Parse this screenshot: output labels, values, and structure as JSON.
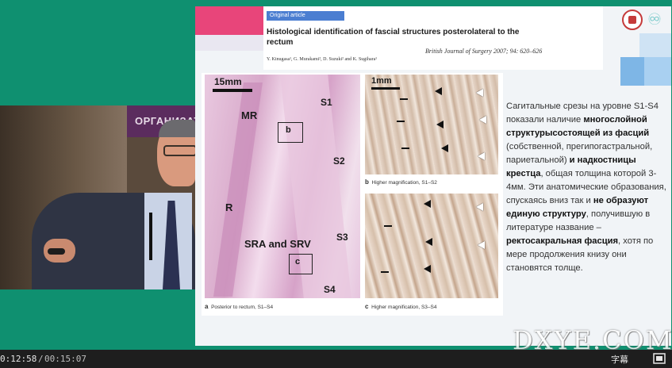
{
  "player": {
    "time_current": "0:12:58",
    "time_separator": "/",
    "time_total": "00:15:07",
    "subtitle_button": "字幕",
    "watermark": "DXYE.COM"
  },
  "speaker_video": {
    "background_sign": "ОРГАНИЗАТО"
  },
  "slide": {
    "article_label": "Original article",
    "article_title": "Histological identification of fascial structures posterolateral to the rectum",
    "journal_citation": "British Journal of Surgery 2007; 94: 620–626",
    "authors": "Y. Kinugasa¹, G. Murakami², D. Suzuki² and K. Sugihara¹",
    "figure": {
      "panel_a": {
        "scale": "15mm",
        "labels": [
          "MR",
          "b",
          "S1",
          "S2",
          "R",
          "S3",
          "SRA and SRV",
          "c",
          "S4"
        ],
        "caption_letter": "a",
        "caption_text": "Posterior to rectum, S1–S4"
      },
      "panel_b": {
        "scale": "1mm",
        "caption_letter": "b",
        "caption_text": "Higher magnification, S1–S2"
      },
      "panel_c": {
        "caption_letter": "c",
        "caption_text": "Higher magnification, S3–S4"
      }
    },
    "body_segments": [
      {
        "text": "Сагитальные срезы на уровне S1-S4 показали наличие ",
        "bold": false
      },
      {
        "text": "многослойной структурысостоящей из фасций",
        "bold": true
      },
      {
        "text": " (собственной, прегипогастральной, париетальной) ",
        "bold": false
      },
      {
        "text": "и надкостницы крестца",
        "bold": true
      },
      {
        "text": ", общая толщина которой 3-4мм. Эти анатомические образования, спускаясь вниз так и ",
        "bold": false
      },
      {
        "text": "не образуют единую структуру",
        "bold": true
      },
      {
        "text": ", получившую в литературе название – ",
        "bold": false
      },
      {
        "text": "ректосакральная фасция",
        "bold": true
      },
      {
        "text": ", хотя по мере продолжения книзу они становятся толще.",
        "bold": false
      }
    ]
  },
  "colors": {
    "background": "#0f9070",
    "slide_accent_pink": "#e8457a",
    "slide_accent_blue": "#4b7ed1",
    "control_bar": "#1e1e1e"
  }
}
